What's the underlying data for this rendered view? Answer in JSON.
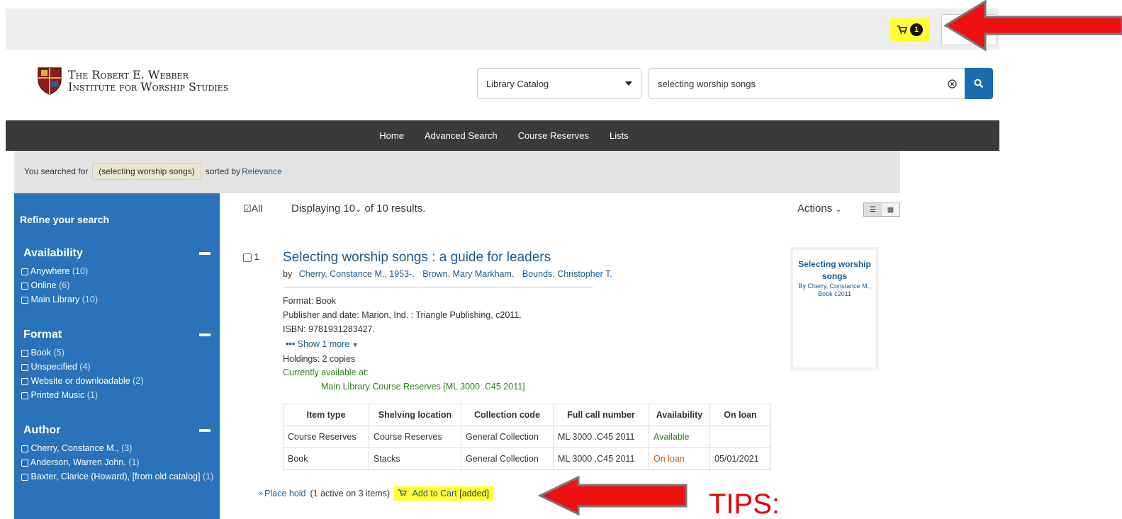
{
  "cart": {
    "count": "1"
  },
  "logo": {
    "line1": "The Robert E. Webber",
    "line2": "Institute for Worship Studies"
  },
  "search": {
    "scope": "Library Catalog",
    "query": "selecting worship songs"
  },
  "nav": [
    "Home",
    "Advanced Search",
    "Course Reserves",
    "Lists"
  ],
  "breadcrumb": {
    "prefix": "You searched for",
    "term": "(selecting worship songs)",
    "sorted_by": "sorted by",
    "sort": "Relevance"
  },
  "sidebar": {
    "title": "Refine your search",
    "facets": [
      {
        "name": "Availability",
        "items": [
          {
            "label": "Anywhere",
            "count": "(10)"
          },
          {
            "label": "Online",
            "count": "(6)"
          },
          {
            "label": "Main Library",
            "count": "(10)"
          }
        ]
      },
      {
        "name": "Format",
        "items": [
          {
            "label": "Book",
            "count": "(5)"
          },
          {
            "label": "Unspecified",
            "count": "(4)"
          },
          {
            "label": "Website or downloadable",
            "count": "(2)"
          },
          {
            "label": "Printed Music",
            "count": "(1)"
          }
        ]
      },
      {
        "name": "Author",
        "items": [
          {
            "label": "Cherry, Constance M.,",
            "count": "(3)"
          },
          {
            "label": "Anderson, Warren John.",
            "count": "(1)"
          },
          {
            "label": "Baxter, Clarice (Howard), [from old catalog]",
            "count": "(1)"
          }
        ]
      }
    ]
  },
  "results": {
    "select_all": "All",
    "displaying": "Displaying 10",
    "of_results": "of 10 results.",
    "actions": "Actions"
  },
  "record": {
    "number": "1",
    "title": "Selecting worship songs : a guide for leaders",
    "by": "by",
    "authors": [
      "Cherry, Constance M., 1953-.",
      "Brown, Mary Markham.",
      "Bounds, Christopher T."
    ],
    "format": "Format: Book",
    "publisher": "Publisher and date:  Marion, Ind. : Triangle Publishing, c2011.",
    "isbn": "ISBN:  9781931283427.",
    "show_more": "Show 1 more",
    "holdings": "Holdings: 2 copies",
    "available_at": "Currently available at:",
    "location": "Main Library Course Reserves [ML 3000 .C45 2011]",
    "cover": {
      "title": "Selecting worship songs",
      "by": "By Cherry, Constance M.,",
      "meta": "Book c2011"
    },
    "table": {
      "headers": [
        "Item type",
        "Shelving location",
        "Collection code",
        "Full call number",
        "Availability",
        "On loan"
      ],
      "rows": [
        [
          "Course Reserves",
          "Course Reserves",
          "General Collection",
          "ML 3000 .C45 2011",
          "Available",
          ""
        ],
        [
          "Book",
          "Stacks",
          "General Collection",
          "ML 3000 .C45 2011",
          "On loan",
          "05/01/2021"
        ]
      ]
    },
    "place_hold": "Place hold",
    "hold_info": "(1 active on 3 items)",
    "add_to_cart": "Add to Cart",
    "added": "[added]"
  },
  "overlay": {
    "tips": "TIPS:"
  },
  "colors": {
    "highlight": "#ffff33",
    "arrow": "#ee1111",
    "sidebar": "#2a72b9"
  }
}
